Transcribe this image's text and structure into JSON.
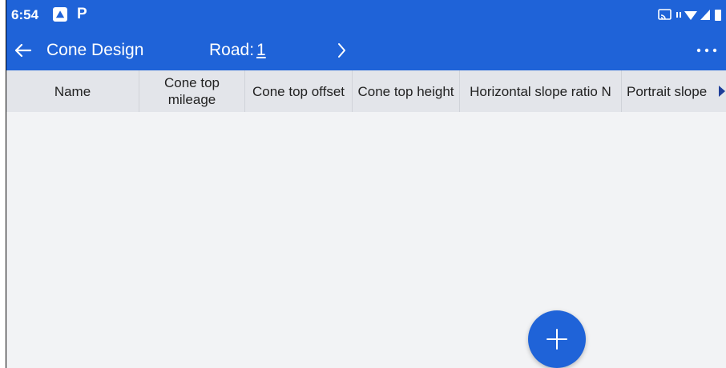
{
  "status_bar": {
    "time": "6:54",
    "app_icon_1": "mountain-photo-app-icon",
    "app_icon_2": "P",
    "icons": [
      "cast-icon",
      "data-arrows-icon",
      "wifi-icon",
      "signal-icon",
      "battery-icon"
    ]
  },
  "title_bar": {
    "title": "Cone Design",
    "road_label": "Road:",
    "road_value": "1",
    "back_icon": "arrow-left-icon",
    "next_icon": "chevron-right-icon",
    "more_icon": "more-horizontal-icon"
  },
  "table": {
    "columns": [
      "Name",
      "Cone top mileage",
      "Cone top offset",
      "Cone top height",
      "Horizontal slope ratio N",
      "Portrait slope"
    ],
    "rows": [],
    "scroll_icon": "triangle-right-icon"
  },
  "fab": {
    "icon": "plus-icon"
  },
  "colors": {
    "primary": "#1f63d8",
    "header_bg": "#e3e5ea",
    "content_bg": "#f2f3f5"
  }
}
